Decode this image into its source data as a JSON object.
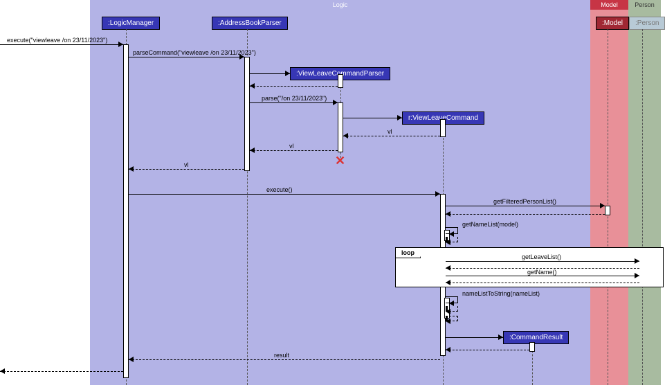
{
  "regions": {
    "logic": {
      "label": "Logic"
    },
    "model": {
      "label": "Model"
    },
    "person": {
      "label": "Person"
    }
  },
  "participants": {
    "logicManager": ":LogicManager",
    "addressBookParser": ":AddressBookParser",
    "viewLeaveParser": ":ViewLeaveCommandParser",
    "viewLeaveCommand": "r:ViewLeaveCommand",
    "commandResult": ":CommandResult",
    "model": ":Model",
    "person": ":Person"
  },
  "messages": {
    "execute1": "execute(\"viewleave /on 23/11/2023\")",
    "parseCommand": "parseCommand(\"viewleave /on 23/11/2023\")",
    "parse": "parse(\"/on 23/11/2023\")",
    "vl1": "vl",
    "vl2": "vl",
    "vl3": "vl",
    "execute2": "execute()",
    "getFiltered": "getFilteredPersonList()",
    "getNameList": "getNameList(model)",
    "getLeaveList": "getLeaveList()",
    "getName": "getName()",
    "nameListToString": "nameListToString(nameList)",
    "result": "result"
  },
  "loop": {
    "label": "loop"
  }
}
